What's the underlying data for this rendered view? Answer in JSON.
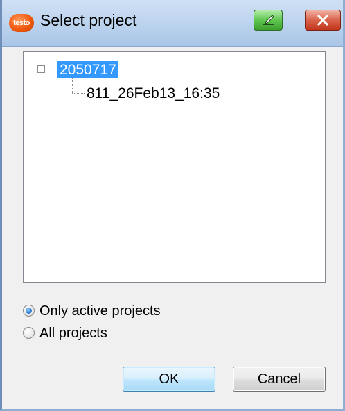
{
  "window": {
    "title": "Select project",
    "logo_text": "testo"
  },
  "tree": {
    "root": {
      "label": "2050717",
      "expanded": true,
      "selected": true,
      "children": [
        {
          "label": "811_26Feb13_16:35"
        }
      ]
    }
  },
  "filter": {
    "options": [
      {
        "label": "Only active projects",
        "checked": true
      },
      {
        "label": "All projects",
        "checked": false
      }
    ]
  },
  "buttons": {
    "ok_label": "OK",
    "cancel_label": "Cancel"
  },
  "colors": {
    "selection": "#3399ff",
    "titlebar": "#bfd5ef",
    "close_button": "#c1361c",
    "extra_button": "#5fc64f"
  },
  "icons": {
    "app": "testo-logo-icon",
    "titlebar_extra": "edit-pen-icon",
    "close": "close-icon",
    "tree_expander": "tree-collapse-icon"
  }
}
